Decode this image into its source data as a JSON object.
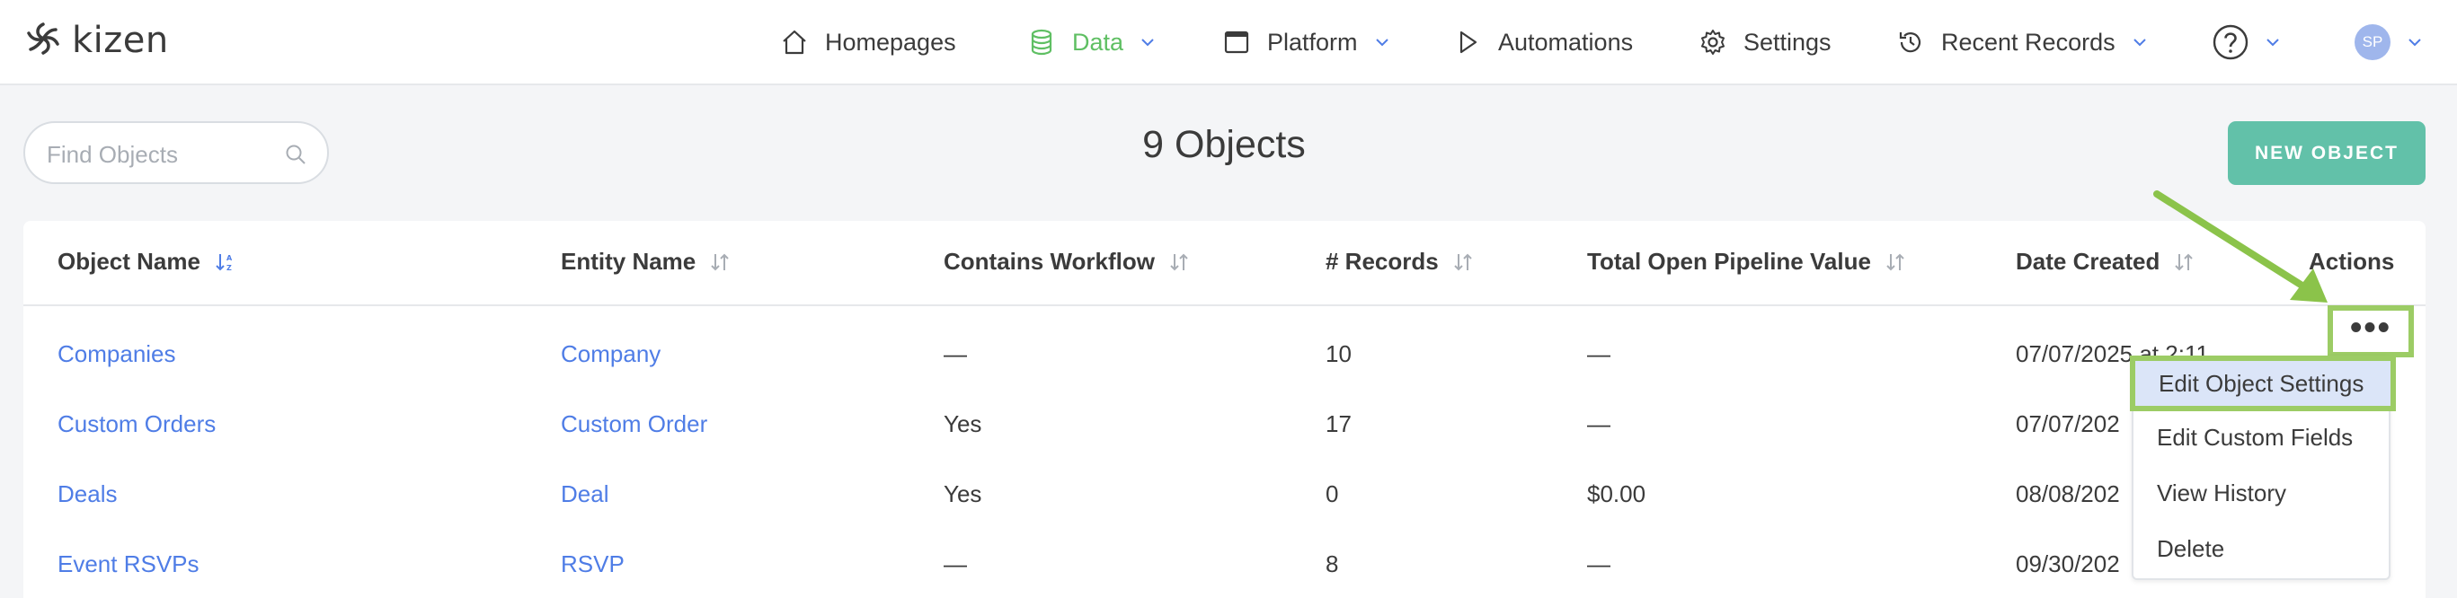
{
  "nav": {
    "logo": "kizen",
    "items": [
      {
        "label": "Homepages",
        "icon": "home-icon"
      },
      {
        "label": "Data",
        "icon": "database-icon"
      },
      {
        "label": "Platform",
        "icon": "window-icon"
      },
      {
        "label": "Automations",
        "icon": "play-icon"
      },
      {
        "label": "Settings",
        "icon": "gear-icon"
      },
      {
        "label": "Recent Records",
        "icon": "history-icon"
      }
    ],
    "avatar": "SP",
    "accent": "#5fbf63"
  },
  "toolbar": {
    "search_placeholder": "Find Objects",
    "title": "9 Objects",
    "new_button": "NEW OBJECT"
  },
  "table": {
    "headers": [
      "Object Name",
      "Entity Name",
      "Contains Workflow",
      "# Records",
      "Total Open Pipeline Value",
      "Date Created",
      "Actions"
    ],
    "rows": [
      {
        "object": "Companies",
        "entity": "Company",
        "workflow": "—",
        "records": "10",
        "pipeline": "—",
        "date": "07/07/2025 at 2:11..."
      },
      {
        "object": "Custom Orders",
        "entity": "Custom Order",
        "workflow": "Yes",
        "records": "17",
        "pipeline": "—",
        "date": "07/07/202"
      },
      {
        "object": "Deals",
        "entity": "Deal",
        "workflow": "Yes",
        "records": "0",
        "pipeline": "$0.00",
        "date": "08/08/202"
      },
      {
        "object": "Event RSVPs",
        "entity": "RSVP",
        "workflow": "—",
        "records": "8",
        "pipeline": "—",
        "date": "09/30/202"
      }
    ]
  },
  "actions_menu": {
    "trigger": "•••",
    "items": [
      "Edit Object Settings",
      "Edit Custom Fields",
      "View History",
      "Delete"
    ]
  },
  "colors": {
    "link": "#4f7de6",
    "button": "#62c1a9",
    "highlight": "#9ccc65",
    "selected_menu_bg": "#dbe5f8"
  }
}
